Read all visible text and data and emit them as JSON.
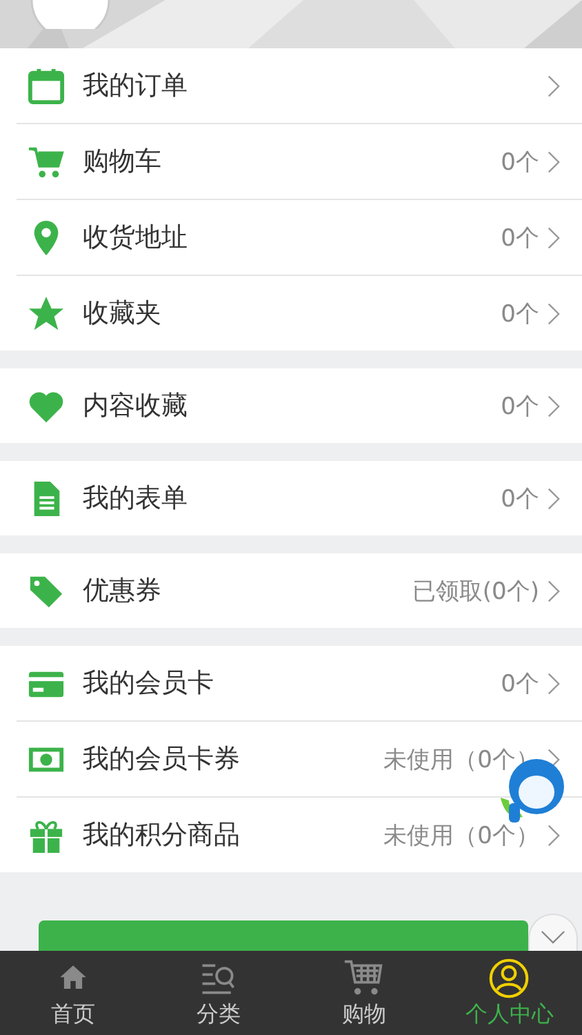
{
  "groups": [
    {
      "items": [
        {
          "label": "我的订单"
        },
        {
          "label": "购物车",
          "value": "0个"
        },
        {
          "label": "收货地址",
          "value": "0个"
        },
        {
          "label": "收藏夹",
          "value": "0个"
        }
      ]
    },
    {
      "items": [
        {
          "label": "内容收藏",
          "value": "0个"
        }
      ]
    },
    {
      "items": [
        {
          "label": "我的表单",
          "value": "0个"
        }
      ]
    },
    {
      "items": [
        {
          "label": "优惠券",
          "value": "已领取(0个)"
        }
      ]
    },
    {
      "items": [
        {
          "label": "我的会员卡",
          "value": "0个"
        },
        {
          "label": "我的会员卡券",
          "value": "未使用（0个）"
        },
        {
          "label": "我的积分商品",
          "value": "未使用（0个）"
        }
      ]
    }
  ],
  "tabs": [
    {
      "label": "首页",
      "selected": false
    },
    {
      "label": "分类",
      "selected": false
    },
    {
      "label": "购物",
      "selected": false
    },
    {
      "label": "个人中心",
      "selected": true
    }
  ]
}
